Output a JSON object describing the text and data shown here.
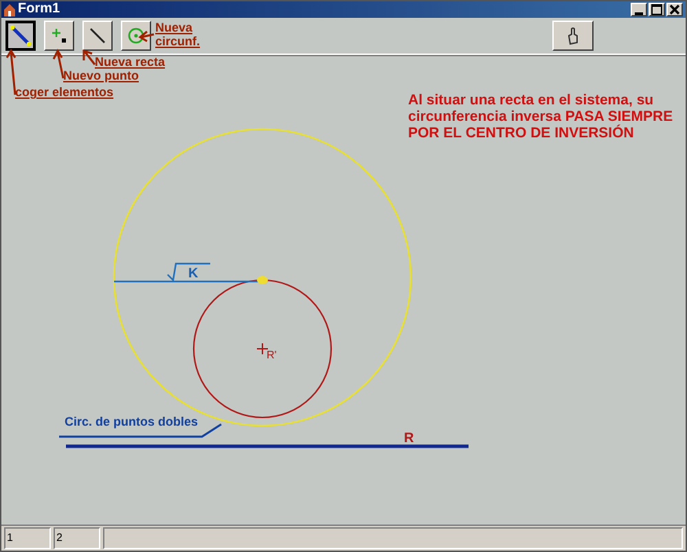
{
  "window": {
    "title": "Form1"
  },
  "toolbar": {
    "tools": [
      {
        "kind": "select",
        "selected": true
      },
      {
        "kind": "point",
        "selected": false
      },
      {
        "kind": "line",
        "selected": false
      },
      {
        "kind": "circle",
        "selected": false
      }
    ]
  },
  "callouts": [
    "Nueva circunf.",
    "Nueva recta",
    "Nuevo punto",
    "coger elementos"
  ],
  "note": "Al situar una recta en el sistema, su circunferencia inversa PASA SIEMPRE POR EL CENTRO DE INVERSIÓN",
  "diagram": {
    "radius_label": "K",
    "center_label": "R'",
    "line_label": "R",
    "circle_label": "Circ. de puntos dobles"
  },
  "status_bar": [
    "1",
    "2"
  ]
}
